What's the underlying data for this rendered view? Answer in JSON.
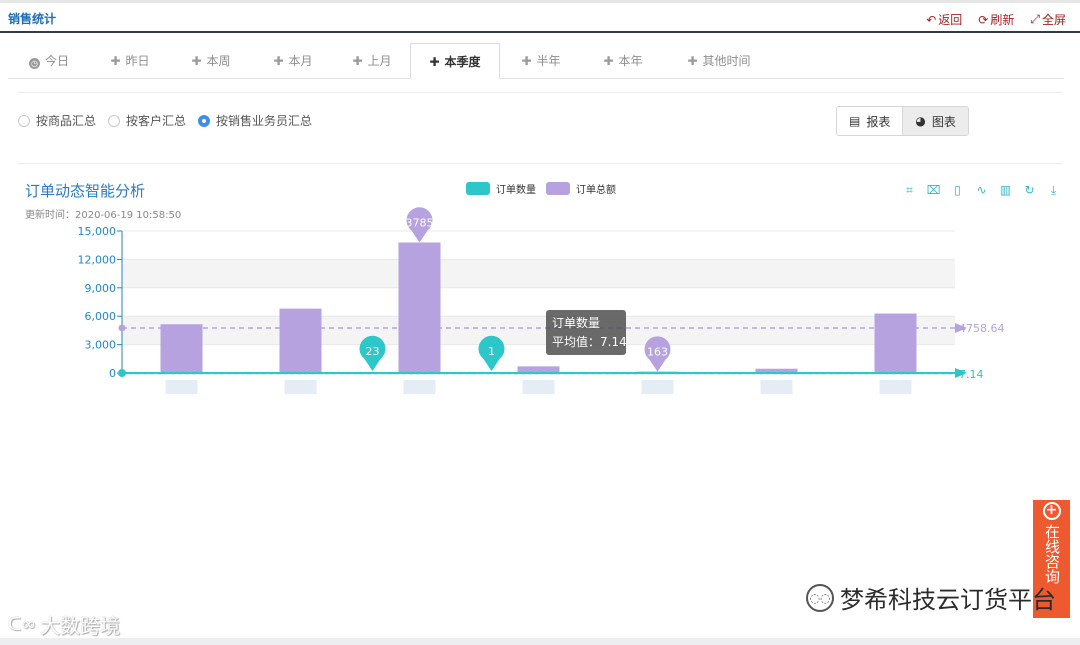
{
  "header": {
    "title": "销售统计",
    "back_label": "返回",
    "refresh_label": "刷新",
    "fullscreen_label": "全屏"
  },
  "tabs": [
    {
      "label": "今日",
      "icon": "clock-icon",
      "active": false
    },
    {
      "label": "昨日",
      "icon": "plus-icon",
      "active": false
    },
    {
      "label": "本周",
      "icon": "plus-icon",
      "active": false
    },
    {
      "label": "本月",
      "icon": "plus-icon",
      "active": false
    },
    {
      "label": "上月",
      "icon": "plus-icon",
      "active": false
    },
    {
      "label": "本季度",
      "icon": "plus-icon",
      "active": true
    },
    {
      "label": "半年",
      "icon": "plus-icon",
      "active": false
    },
    {
      "label": "本年",
      "icon": "plus-icon",
      "active": false
    },
    {
      "label": "其他时间",
      "icon": "plus-icon",
      "active": false
    }
  ],
  "grouping": {
    "options": [
      "按商品汇总",
      "按客户汇总",
      "按销售业务员汇总"
    ],
    "selected": "按销售业务员汇总"
  },
  "view_toggle": {
    "report_label": "报表",
    "chart_label": "图表",
    "active": "图表"
  },
  "chart_panel": {
    "title": "订单动态智能分析",
    "updated": "更新时间：2020-06-19 10:58:50",
    "toolbox_icons": [
      "zoom-icon",
      "zoom-reset-icon",
      "data-view-icon",
      "line-icon",
      "bar-icon",
      "restore-icon",
      "download-icon"
    ]
  },
  "chart_data": {
    "type": "bar",
    "categories": [
      "",
      "",
      "",
      "",
      "",
      "",
      ""
    ],
    "series": [
      {
        "name": "订单数量",
        "color": "#2ec7c9",
        "values": [
          1,
          1,
          23,
          1,
          2,
          1,
          2
        ],
        "markers": [
          {
            "index": 2,
            "label": "23"
          },
          {
            "index": 3,
            "label": "1"
          }
        ],
        "average": 7.14,
        "average_label": "7.14"
      },
      {
        "name": "订单总额",
        "color": "#b6a2de",
        "values": [
          5150,
          6800,
          13785,
          700,
          150,
          450,
          6280
        ],
        "markers": [
          {
            "index": 2,
            "label": "3785"
          },
          {
            "index": 4,
            "label": "163"
          }
        ],
        "average": 4758.64,
        "average_label": "4758.64"
      }
    ],
    "y_ticks": [
      "15,000",
      "12,000",
      "9,000",
      "6,000",
      "3,000",
      "0"
    ],
    "ylim": [
      0,
      15000
    ],
    "tooltip": {
      "title": "订单数量",
      "line": "平均值：7.14"
    },
    "grid": true,
    "legend_position": "top-center"
  },
  "consult": {
    "label": "在线咨询"
  },
  "watermarks": {
    "brand": "梦希科技云订货平台",
    "source": "大数跨境"
  }
}
